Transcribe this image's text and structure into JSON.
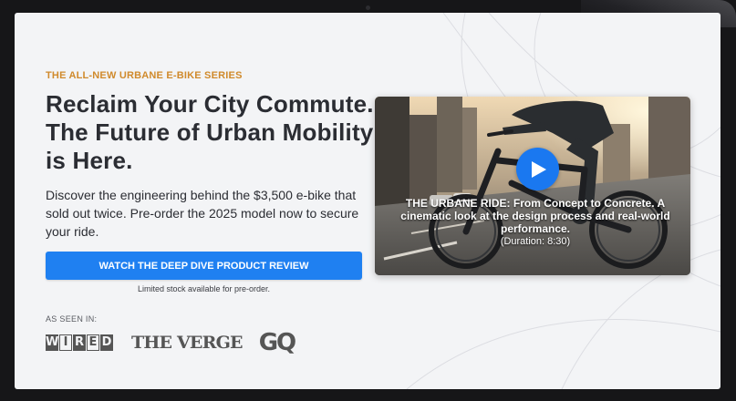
{
  "hero": {
    "eyebrow": "THE ALL-NEW URBANE E-BIKE SERIES",
    "headline": "Reclaim Your City Commute. The Future of Urban Mobility is Here.",
    "description": "Discover the engineering behind the $3,500 e-bike that sold out twice. Pre-order the 2025 model now to secure your ride.",
    "cta_label": "WATCH THE DEEP DIVE PRODUCT REVIEW",
    "stock_note": "Limited stock available for pre-order."
  },
  "press": {
    "label": "AS SEEN IN:",
    "logos": [
      "WIRED",
      "THE VERGE",
      "GQ"
    ]
  },
  "video": {
    "title": "THE URBANE RIDE: From Concept to Concrete. A cinematic look at the design process and real-world performance.",
    "duration": "(Duration: 8:30)",
    "play_icon": "play-icon"
  },
  "colors": {
    "accent": "#1f80f1",
    "eyebrow": "#d08a2c",
    "text": "#2b2d33",
    "background": "#f3f4f6"
  }
}
